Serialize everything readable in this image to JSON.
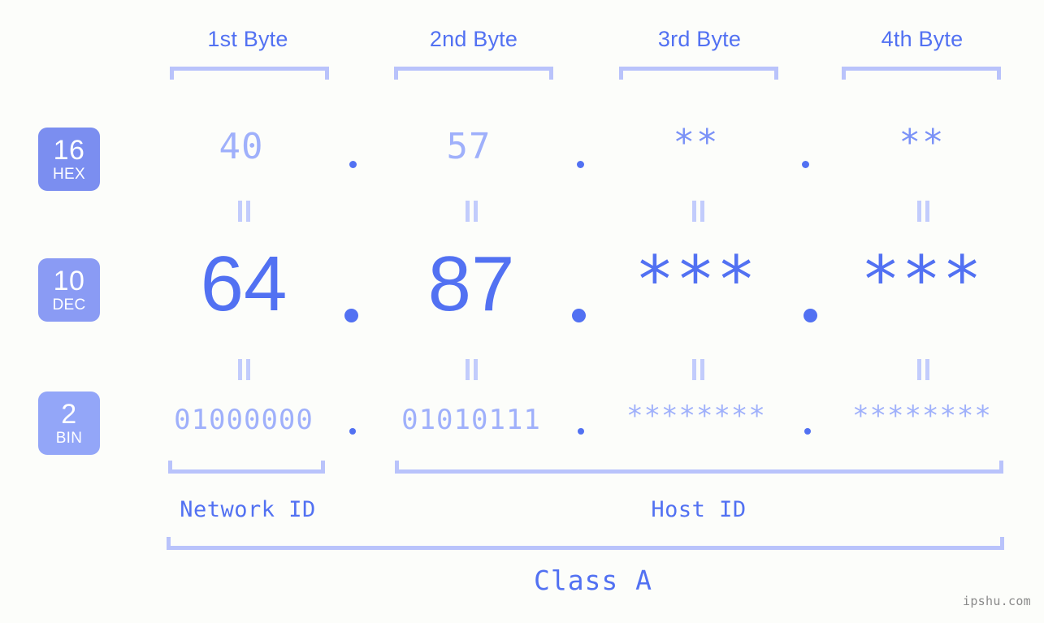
{
  "background_color": "#fcfdfa",
  "accent_color": "#5271f2",
  "accent_light_color": "#9fb0fb",
  "bracket_color": "#b9c3fb",
  "headers": [
    {
      "label": "1st Byte"
    },
    {
      "label": "2nd Byte"
    },
    {
      "label": "3rd Byte"
    },
    {
      "label": "4th Byte"
    }
  ],
  "bases": [
    {
      "number": "16",
      "name": "HEX",
      "color": "#7b8ef0"
    },
    {
      "number": "10",
      "name": "DEC",
      "color": "#8a9bf4"
    },
    {
      "number": "2",
      "name": "BIN",
      "color": "#93a6f8"
    }
  ],
  "rows": {
    "hex": {
      "values": [
        "40",
        "57",
        "**",
        "**"
      ]
    },
    "dec": {
      "values": [
        "64",
        "87",
        "***",
        "***"
      ]
    },
    "bin": {
      "values": [
        "01000000",
        "01010111",
        "********",
        "********"
      ]
    }
  },
  "separator": ".",
  "equality_symbol": "||",
  "sections": [
    {
      "label": "Network ID"
    },
    {
      "label": "Host ID"
    }
  ],
  "class": {
    "label": "Class A"
  },
  "watermark": {
    "text": "ipshu.com"
  }
}
